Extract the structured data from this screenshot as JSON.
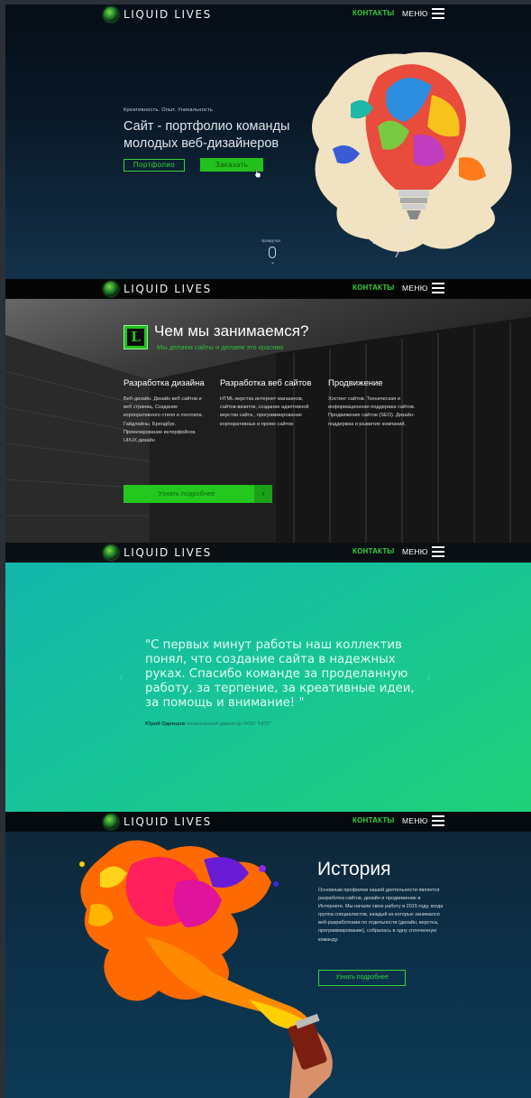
{
  "brand": {
    "logo_text": "LIQUID LIVES"
  },
  "nav": {
    "contacts": "КОНТАКТЫ",
    "menu": "МЕНЮ"
  },
  "hero": {
    "tagline": "Креативность. Опыт. Уникальность",
    "title": "Сайт - портфолио команды молодых веб-дизайнеров",
    "btn_portfolio": "Портфолио",
    "btn_order": "Заказать",
    "scroll_label": "прокрутка"
  },
  "what": {
    "badge": "L",
    "title": "Чем мы занимаемся?",
    "subtitle": "Мы делаем сайты и делаем это красиво",
    "columns": [
      {
        "heading": "Разработка дизайна",
        "text": "Веб-дизайн. Дизайн веб сайтов и веб страниц. Создание корпоративного стиля и логотипа. Гайдлайны. Брендбук. Проектирование интерфейсов. UI/UX дизайн"
      },
      {
        "heading": "Разработка веб сайтов",
        "text": "HTML-верстка интернет магазинов, сайтов-визиток, создание адаптивной верстки сайта , программирование корпоративных и промо сайтов"
      },
      {
        "heading": "Продвижение",
        "text": "Хостинг сайтов. Техническая и информационная поддержка сайтов. Продвижение сайтов (SEO). Дизайн-поддержка и развитие компаний."
      }
    ],
    "btn_more": "Узнать подробнее",
    "btn_more_arrow": "›"
  },
  "testimonial": {
    "quote": "\"С первых минут работы наш коллектив понял, что создание сайта в надежных руках. Спасибо команде за проделанную работу, за терпение, за креативные идеи, за помощь и внимание! \"",
    "author_name": "Юрий Одинцов",
    "author_role": "генеральный директор ООО \"НПУ\"",
    "prev": "‹",
    "next": "›"
  },
  "history": {
    "title": "История",
    "text": "Основным профилем нашей деятельности является разработка сайтов, дизайн и продвижение в Интернете. Мы начали свою работу в 2015 году, когда группа специалистов, каждый из которых занимался веб-разработками по отдельности (дизайн, верстка, программирование), собралась в одну сплоченную команду.",
    "btn_more": "Узнать подробнее"
  },
  "colors": {
    "accent": "#22c11d",
    "hero_bg": "#0a1a2a",
    "testimonial_bg": "#17c39a",
    "history_bg": "#0c3049"
  }
}
